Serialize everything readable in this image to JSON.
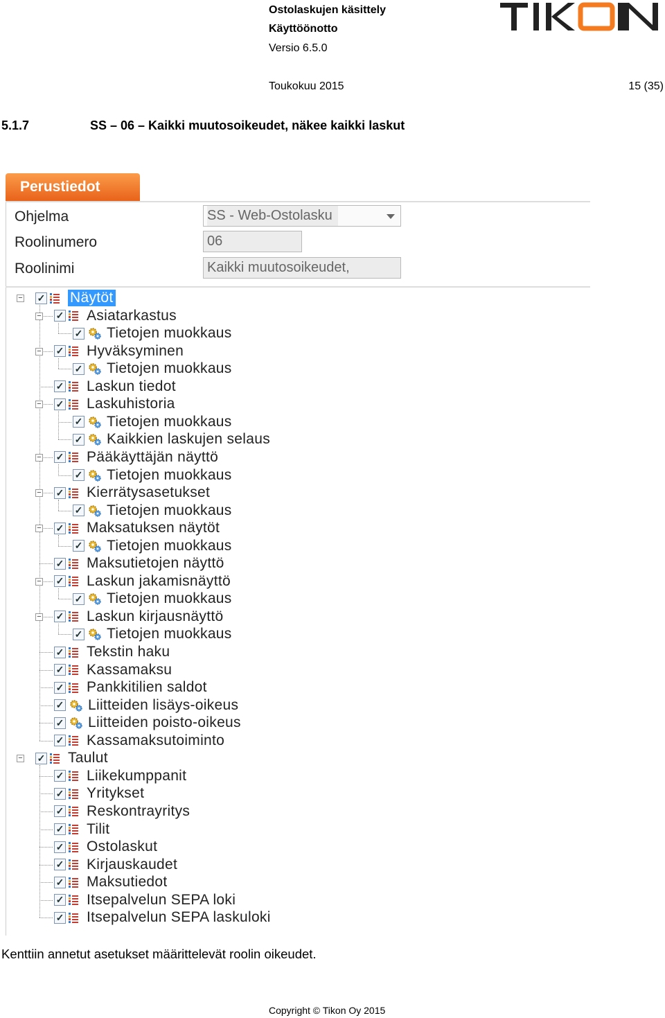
{
  "header": {
    "title": "Ostolaskujen käsittely",
    "subtitle": "Käyttöönotto",
    "version": "Versio 6.5.0",
    "date": "Toukokuu 2015",
    "page": "15 (35)",
    "logo_text": "TIKON",
    "logo_colors": {
      "text": "#222222",
      "accent": "#f47b20"
    }
  },
  "section": {
    "number": "5.1.7",
    "title": "SS – 06 – Kaikki muutosoikeudet, näkee kaikki laskut"
  },
  "screenshot": {
    "tab_label": "Perustiedot",
    "form": {
      "program_label": "Ohjelma",
      "program_value": "SS - Web-Ostolasku",
      "role_number_label": "Roolinumero",
      "role_number_value": "06",
      "role_name_label": "Roolinimi",
      "role_name_value": "Kaikki muutosoikeudet,"
    },
    "tree": [
      {
        "label": "Näytöt",
        "level": 0,
        "icon": "tree-icon",
        "expanded": true,
        "selected": true
      },
      {
        "label": "Asiatarkastus",
        "level": 1,
        "icon": "tree-icon",
        "expanded": true
      },
      {
        "label": "Tietojen muokkaus",
        "level": 2,
        "icon": "gear-icon"
      },
      {
        "label": "Hyväksyminen",
        "level": 1,
        "icon": "tree-icon",
        "expanded": true
      },
      {
        "label": "Tietojen muokkaus",
        "level": 2,
        "icon": "gear-icon"
      },
      {
        "label": "Laskun tiedot",
        "level": 1,
        "icon": "tree-icon"
      },
      {
        "label": "Laskuhistoria",
        "level": 1,
        "icon": "tree-icon",
        "expanded": true
      },
      {
        "label": "Tietojen muokkaus",
        "level": 2,
        "icon": "gear-icon"
      },
      {
        "label": "Kaikkien laskujen selaus",
        "level": 2,
        "icon": "gear-icon"
      },
      {
        "label": "Pääkäyttäjän näyttö",
        "level": 1,
        "icon": "tree-icon",
        "expanded": true
      },
      {
        "label": "Tietojen muokkaus",
        "level": 2,
        "icon": "gear-icon"
      },
      {
        "label": "Kierrätysasetukset",
        "level": 1,
        "icon": "tree-icon",
        "expanded": true
      },
      {
        "label": "Tietojen muokkaus",
        "level": 2,
        "icon": "gear-icon"
      },
      {
        "label": "Maksatuksen näytöt",
        "level": 1,
        "icon": "tree-icon",
        "expanded": true
      },
      {
        "label": "Tietojen muokkaus",
        "level": 2,
        "icon": "gear-icon"
      },
      {
        "label": "Maksutietojen näyttö",
        "level": 1,
        "icon": "tree-icon"
      },
      {
        "label": "Laskun jakamisnäyttö",
        "level": 1,
        "icon": "tree-icon",
        "expanded": true
      },
      {
        "label": "Tietojen muokkaus",
        "level": 2,
        "icon": "gear-icon"
      },
      {
        "label": "Laskun kirjausnäyttö",
        "level": 1,
        "icon": "tree-icon",
        "expanded": true
      },
      {
        "label": "Tietojen muokkaus",
        "level": 2,
        "icon": "gear-icon"
      },
      {
        "label": "Tekstin haku",
        "level": 1,
        "icon": "tree-icon"
      },
      {
        "label": "Kassamaksu",
        "level": 1,
        "icon": "tree-icon"
      },
      {
        "label": "Pankkitilien saldot",
        "level": 1,
        "icon": "tree-icon"
      },
      {
        "label": "Liitteiden lisäys-oikeus",
        "level": 1,
        "icon": "gear-icon"
      },
      {
        "label": "Liitteiden poisto-oikeus",
        "level": 1,
        "icon": "gear-icon"
      },
      {
        "label": "Kassamaksutoiminto",
        "level": 1,
        "icon": "tree-icon"
      },
      {
        "label": "Taulut",
        "level": 0,
        "icon": "tree-icon",
        "expanded": true
      },
      {
        "label": "Liikekumppanit",
        "level": 1,
        "icon": "tree-icon"
      },
      {
        "label": "Yritykset",
        "level": 1,
        "icon": "tree-icon"
      },
      {
        "label": "Reskontrayritys",
        "level": 1,
        "icon": "tree-icon"
      },
      {
        "label": "Tilit",
        "level": 1,
        "icon": "tree-icon"
      },
      {
        "label": "Ostolaskut",
        "level": 1,
        "icon": "tree-icon"
      },
      {
        "label": "Kirjauskaudet",
        "level": 1,
        "icon": "tree-icon"
      },
      {
        "label": "Maksutiedot",
        "level": 1,
        "icon": "tree-icon"
      },
      {
        "label": "Itsepalvelun SEPA loki",
        "level": 1,
        "icon": "tree-icon"
      },
      {
        "label": "Itsepalvelun SEPA laskuloki",
        "level": 1,
        "icon": "tree-icon"
      }
    ]
  },
  "caption": "Kenttiin annetut asetukset määrittelevät roolin oikeudet.",
  "copyright": "Copyright © Tikon Oy 2015",
  "colors": {
    "tab": "#f07a2a",
    "selection": "#3399ff"
  }
}
